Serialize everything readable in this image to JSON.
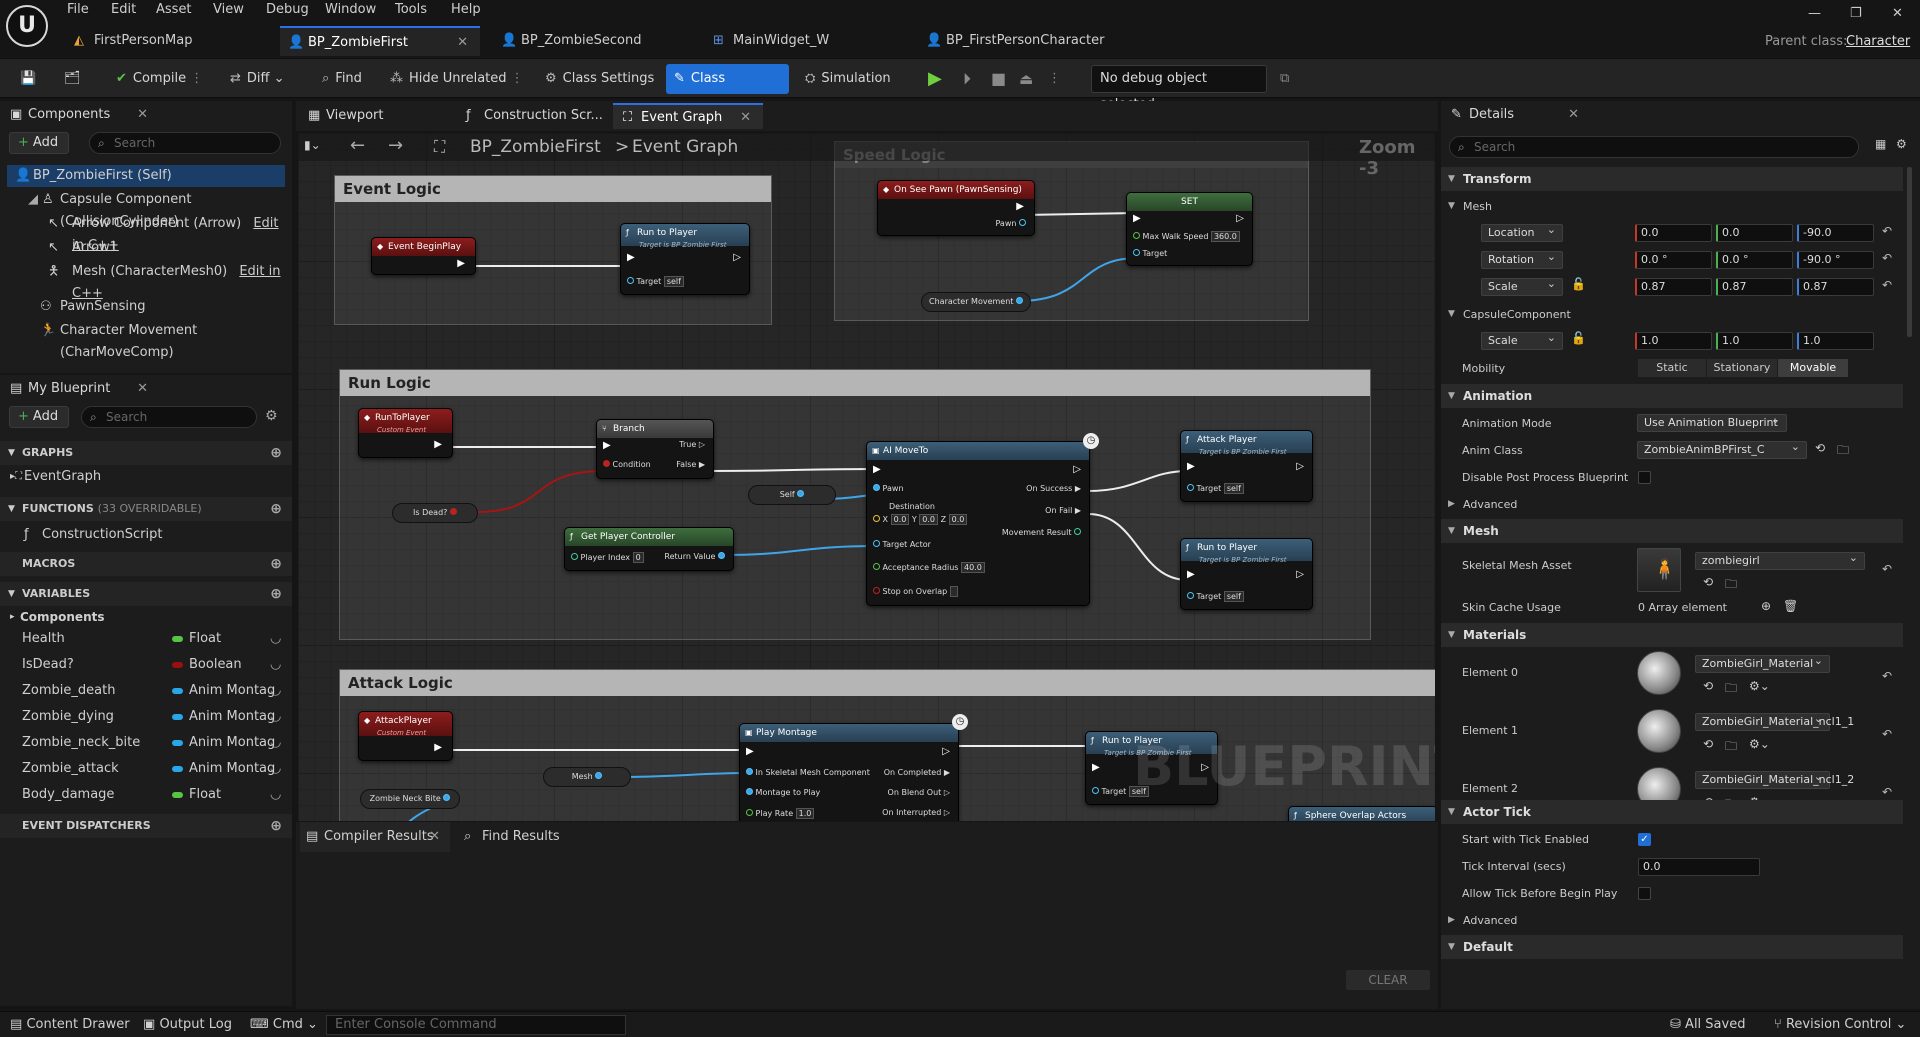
{
  "menu": [
    "File",
    "Edit",
    "Asset",
    "View",
    "Debug",
    "Window",
    "Tools",
    "Help"
  ],
  "doc_tabs": [
    {
      "label": "FirstPersonMap"
    },
    {
      "label": "BP_ZombieFirst"
    },
    {
      "label": "BP_ZombieSecond"
    },
    {
      "label": "MainWidget_W"
    },
    {
      "label": "BP_FirstPersonCharacter"
    }
  ],
  "parent_class": {
    "label": "Parent class:",
    "value": "Character"
  },
  "toolbar": {
    "compile": "Compile",
    "diff": "Diff",
    "find": "Find",
    "hide_unrelated": "Hide Unrelated",
    "class_settings": "Class Settings",
    "class_defaults": "Class Defaults",
    "simulation": "Simulation",
    "debug_object": "No debug object selected"
  },
  "components_panel": {
    "title": "Components",
    "add": "Add",
    "search_placeholder": "Search",
    "items": [
      {
        "label": "BP_ZombieFirst (Self)"
      },
      {
        "label": "Capsule Component (CollisionCylinder)"
      },
      {
        "label": "Arrow Component (Arrow)",
        "link": "Edit in C++"
      },
      {
        "label": "Arrow1"
      },
      {
        "label": "Mesh (CharacterMesh0)",
        "link": "Edit in C++"
      },
      {
        "label": "PawnSensing"
      },
      {
        "label": "Character Movement (CharMoveComp)"
      }
    ]
  },
  "my_blueprint": {
    "title": "My Blueprint",
    "add": "Add",
    "search_placeholder": "Search",
    "graphs_label": "GRAPHS",
    "event_graph": "EventGraph",
    "functions_label": "FUNCTIONS",
    "functions_note": "(33 OVERRIDABLE)",
    "construction_script": "ConstructionScript",
    "macros_label": "MACROS",
    "variables_label": "VARIABLES",
    "components_label": "Components",
    "variables": [
      {
        "name": "Health",
        "type": "Float",
        "color": "#57c443"
      },
      {
        "name": "IsDead?",
        "type": "Boolean",
        "color": "#9a1010"
      },
      {
        "name": "Zombie_death",
        "type": "Anim Montag",
        "color": "#29a6e8"
      },
      {
        "name": "Zombie_dying",
        "type": "Anim Montag",
        "color": "#29a6e8"
      },
      {
        "name": "Zombie_neck_bite",
        "type": "Anim Montag",
        "color": "#29a6e8"
      },
      {
        "name": "Zombie_attack",
        "type": "Anim Montag",
        "color": "#29a6e8"
      },
      {
        "name": "Body_damage",
        "type": "Float",
        "color": "#57c443"
      }
    ],
    "event_dispatchers_label": "EVENT DISPATCHERS"
  },
  "editor_tabs": [
    {
      "label": "Viewport"
    },
    {
      "label": "Construction Scr..."
    },
    {
      "label": "Event Graph"
    }
  ],
  "breadcrumb": {
    "blueprint": "BP_ZombieFirst",
    "sep": ">",
    "graph": "Event Graph"
  },
  "graph": {
    "zoom": "Zoom -3",
    "watermark": "BLUEPRINT",
    "comments": {
      "event": "Event Logic",
      "speed": "Speed Logic",
      "run": "Run Logic",
      "attack": "Attack Logic"
    },
    "nodes": {
      "event_begin_play": "Event BeginPlay",
      "run_to_player": "Run to Player",
      "target_is_zombie": "Target is BP Zombie First",
      "target": "Target",
      "self": "self",
      "on_see_pawn": "On See Pawn (PawnSensing)",
      "pawn": "Pawn",
      "set": "SET",
      "max_walk_speed": "Max Walk Speed",
      "max_walk_speed_value": "360.0",
      "character_movement": "Character Movement",
      "run_to_player_event": "RunToPlayer",
      "custom_event": "Custom Event",
      "branch": "Branch",
      "true": "True",
      "false": "False",
      "condition": "Condition",
      "is_dead": "Is Dead?",
      "self_var": "Self",
      "get_player_controller": "Get Player Controller",
      "player_index": "Player Index",
      "player_index_value": "0",
      "return_value": "Return Value",
      "ai_move_to": "AI MoveTo",
      "destination": "Destination",
      "x": "X",
      "y": "Y",
      "z": "Z",
      "dest_val": "0.0",
      "target_actor": "Target Actor",
      "acceptance_radius": "Acceptance Radius",
      "acceptance_radius_value": "40.0",
      "stop_on_overlap": "Stop on Overlap",
      "on_success": "On Success",
      "on_fail": "On Fail",
      "movement_result": "Movement Result",
      "attack_player": "Attack Player",
      "attack_player_event": "AttackPlayer",
      "play_montage": "Play Montage",
      "in_skeletal_mesh": "In Skeletal Mesh Component",
      "montage_to_play": "Montage to Play",
      "play_rate": "Play Rate",
      "play_rate_value": "1.0",
      "on_completed": "On Completed",
      "on_blend_out": "On Blend Out",
      "on_interrupted": "On Interrupted",
      "mesh": "Mesh",
      "zombie_neck_bite": "Zombie Neck Bite",
      "sphere_overlap": "Sphere Overlap Actors"
    }
  },
  "bottom": {
    "compiler_results": "Compiler Results",
    "find_results": "Find Results",
    "clear": "CLEAR"
  },
  "details": {
    "title": "Details",
    "search_placeholder": "Search",
    "transform": "Transform",
    "mesh_label": "Mesh",
    "location": {
      "label": "Location",
      "x": "0.0",
      "y": "0.0",
      "z": "-90.0"
    },
    "rotation": {
      "label": "Rotation",
      "x": "0.0 °",
      "y": "0.0 °",
      "z": "-90.0 °"
    },
    "scale": {
      "label": "Scale",
      "x": "0.87",
      "y": "0.87",
      "z": "0.87"
    },
    "capsule_component": "CapsuleComponent",
    "capsule_scale": {
      "label": "Scale",
      "x": "1.0",
      "y": "1.0",
      "z": "1.0"
    },
    "mobility": {
      "label": "Mobility",
      "options": [
        "Static",
        "Stationary",
        "Movable"
      ],
      "selected": "Movable"
    },
    "animation": "Animation",
    "anim_mode": {
      "label": "Animation Mode",
      "value": "Use Animation Blueprint"
    },
    "anim_class": {
      "label": "Anim Class",
      "value": "ZombieAnimBPFirst_C"
    },
    "disable_pp": "Disable Post Process Blueprint",
    "advanced": "Advanced",
    "mesh_section": "Mesh",
    "skeletal_mesh": {
      "label": "Skeletal Mesh Asset",
      "value": "zombiegirl"
    },
    "skin_cache": {
      "label": "Skin Cache Usage",
      "value": "0 Array element"
    },
    "materials": "Materials",
    "elements": [
      {
        "label": "Element 0",
        "value": "ZombieGirl_Material"
      },
      {
        "label": "Element 1",
        "value": "ZombieGirl_Material_ncl1_1"
      },
      {
        "label": "Element 2",
        "value": "ZombieGirl_Material_ncl1_2"
      }
    ],
    "actor_tick": "Actor Tick",
    "start_tick": {
      "label": "Start with Tick Enabled",
      "checked": true
    },
    "tick_interval": {
      "label": "Tick Interval (secs)",
      "value": "0.0"
    },
    "allow_tick": {
      "label": "Allow Tick Before Begin Play",
      "checked": false
    },
    "advanced2": "Advanced",
    "default": "Default"
  },
  "status": {
    "content_drawer": "Content Drawer",
    "output_log": "Output Log",
    "cmd": "Cmd",
    "console_placeholder": "Enter Console Command",
    "all_saved": "All Saved",
    "revision_control": "Revision Control"
  }
}
